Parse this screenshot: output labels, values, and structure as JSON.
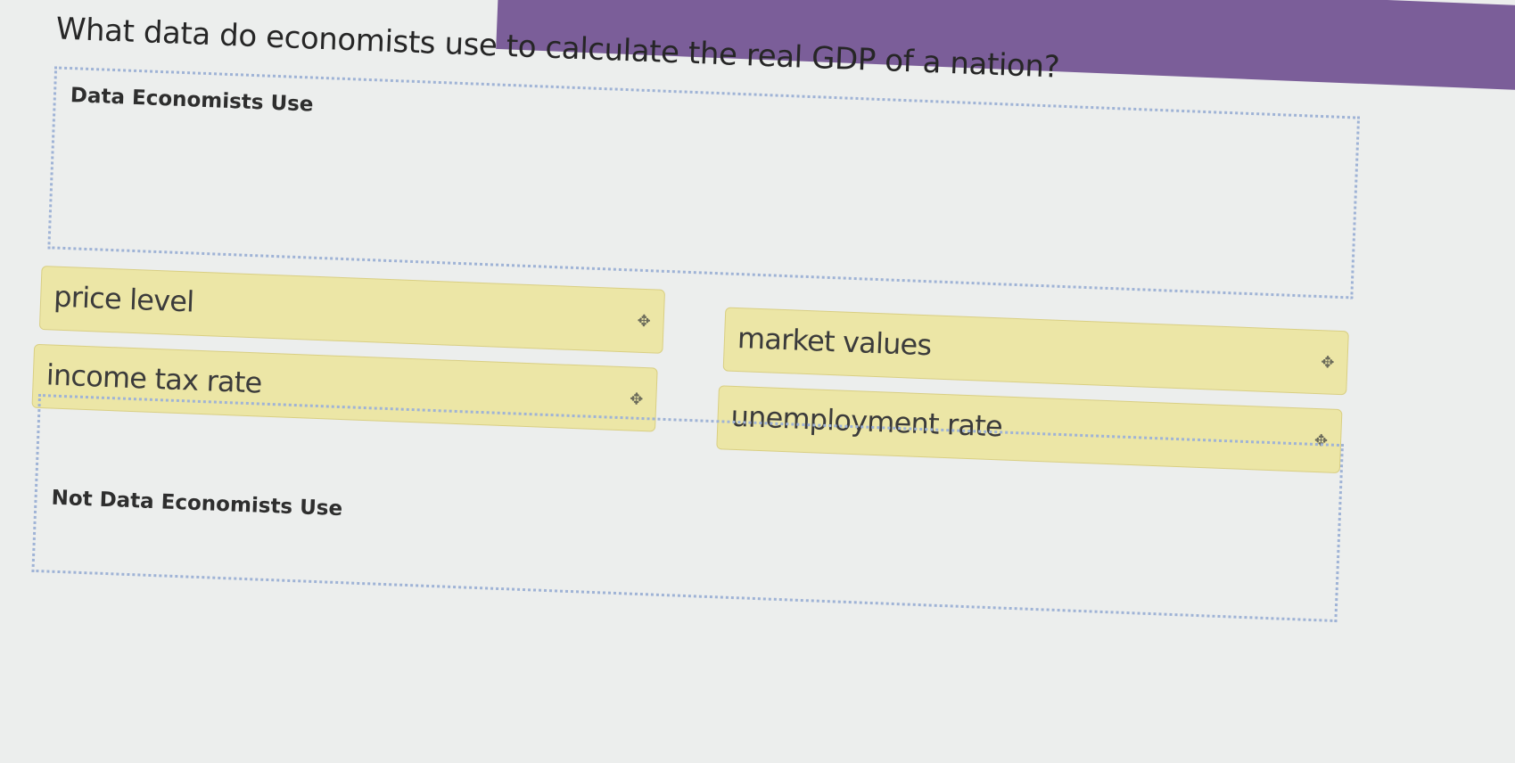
{
  "question": "What data do economists use to calculate the real GDP of a nation?",
  "zones": {
    "use_label": "Data Economists Use",
    "not_use_label": "Not Data Economists Use"
  },
  "cards": [
    {
      "label": "price level"
    },
    {
      "label": "income tax rate"
    },
    {
      "label": "market values"
    },
    {
      "label": "unemployment rate"
    }
  ],
  "icons": {
    "drag_handle": "move-arrows-icon"
  },
  "colors": {
    "card_background": "#ece6a6",
    "dropzone_border": "#9fb3d6",
    "header_band": "#7b5e99"
  }
}
